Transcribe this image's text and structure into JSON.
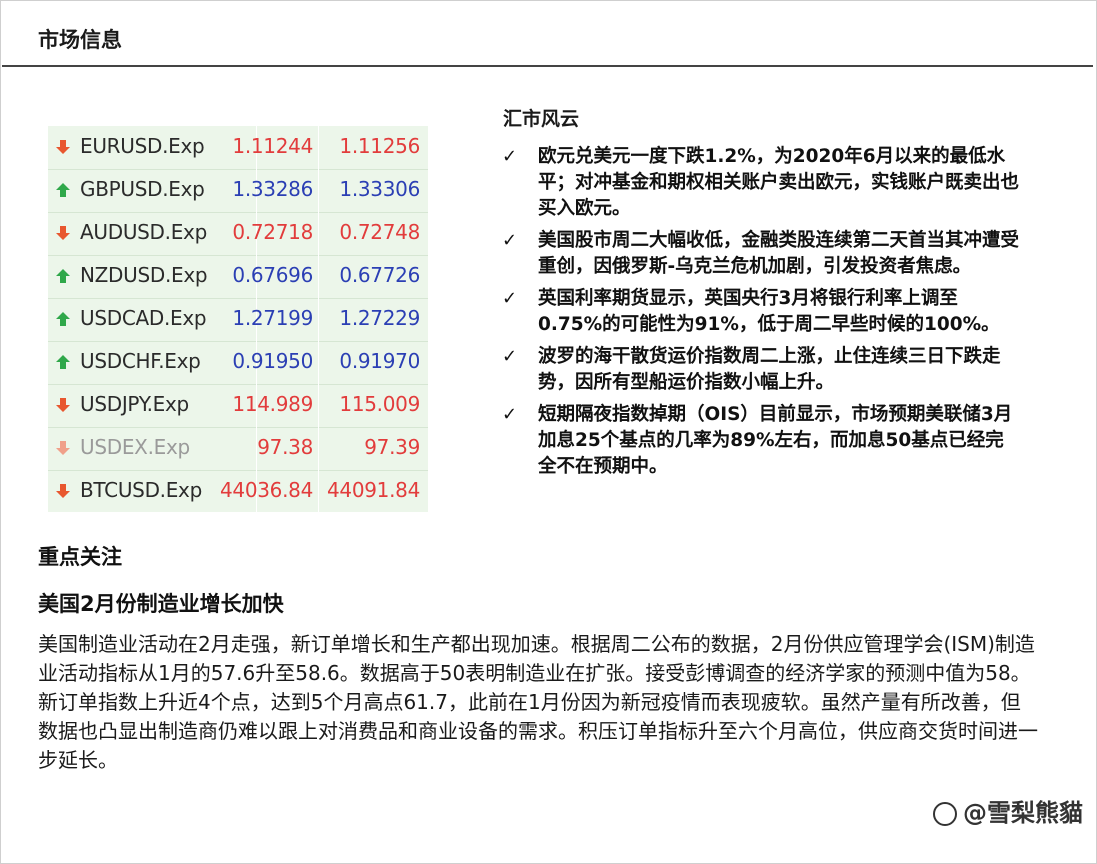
{
  "header": {
    "title": "市场信息"
  },
  "quotes": [
    {
      "symbol": "EURUSD.Exp",
      "bid": "1.11244",
      "ask": "1.11256",
      "direction": "down"
    },
    {
      "symbol": "GBPUSD.Exp",
      "bid": "1.33286",
      "ask": "1.33306",
      "direction": "up"
    },
    {
      "symbol": "AUDUSD.Exp",
      "bid": "0.72718",
      "ask": "0.72748",
      "direction": "down"
    },
    {
      "symbol": "NZDUSD.Exp",
      "bid": "0.67696",
      "ask": "0.67726",
      "direction": "up"
    },
    {
      "symbol": "USDCAD.Exp",
      "bid": "1.27199",
      "ask": "1.27229",
      "direction": "up"
    },
    {
      "symbol": "USDCHF.Exp",
      "bid": "0.91950",
      "ask": "0.91970",
      "direction": "up"
    },
    {
      "symbol": "USDJPY.Exp",
      "bid": "114.989",
      "ask": "115.009",
      "direction": "down"
    },
    {
      "symbol": "USDEX.Exp",
      "bid": "97.38",
      "ask": "97.39",
      "direction": "down",
      "dimmed": true
    },
    {
      "symbol": "BTCUSD.Exp",
      "bid": "44036.84",
      "ask": "44091.84",
      "direction": "down"
    }
  ],
  "fx_news": {
    "title": "汇市风云",
    "items": [
      "欧元兑美元一度下跌1.2%，为2020年6月以来的最低水平；对冲基金和期权相关账户卖出欧元，实钱账户既卖出也买入欧元。",
      "美国股市周二大幅收低，金融类股连续第二天首当其冲遭受重创，因俄罗斯-乌克兰危机加剧，引发投资者焦虑。",
      "英国利率期货显示，英国央行3月将银行利率上调至0.75%的可能性为91%，低于周二早些时候的100%。",
      "波罗的海干散货运价指数周二上涨，止住连续三日下跌走势，因所有型船运价指数小幅上升。",
      "短期隔夜指数掉期（OIS）目前显示，市场预期美联储3月加息25个基点的几率为89%左右，而加息50基点已经完全不在预期中。"
    ]
  },
  "focus": {
    "title": "重点关注",
    "headline": "美国2月份制造业增长加快",
    "body": "美国制造业活动在2月走强，新订单增长和生产都出现加速。根据周二公布的数据，2月份供应管理学会(ISM)制造业活动指标从1月的57.6升至58.6。数据高于50表明制造业在扩张。接受彭博调查的经济学家的预测中值为58。新订单指数上升近4个点，达到5个月高点61.7，此前在1月份因为新冠疫情而表现疲软。虽然产量有所改善，但数据也凸显出制造商仍难以跟上对消费品和商业设备的需求。积压订单指标升至六个月高位，供应商交货时间进一步延长。"
  },
  "watermark": {
    "text": "@雪梨熊貓"
  },
  "colors": {
    "down": "#e23c3c",
    "up": "#2b3fb4",
    "up_arrow": "#2fa84a",
    "table_bg": "#ecf6ea"
  }
}
